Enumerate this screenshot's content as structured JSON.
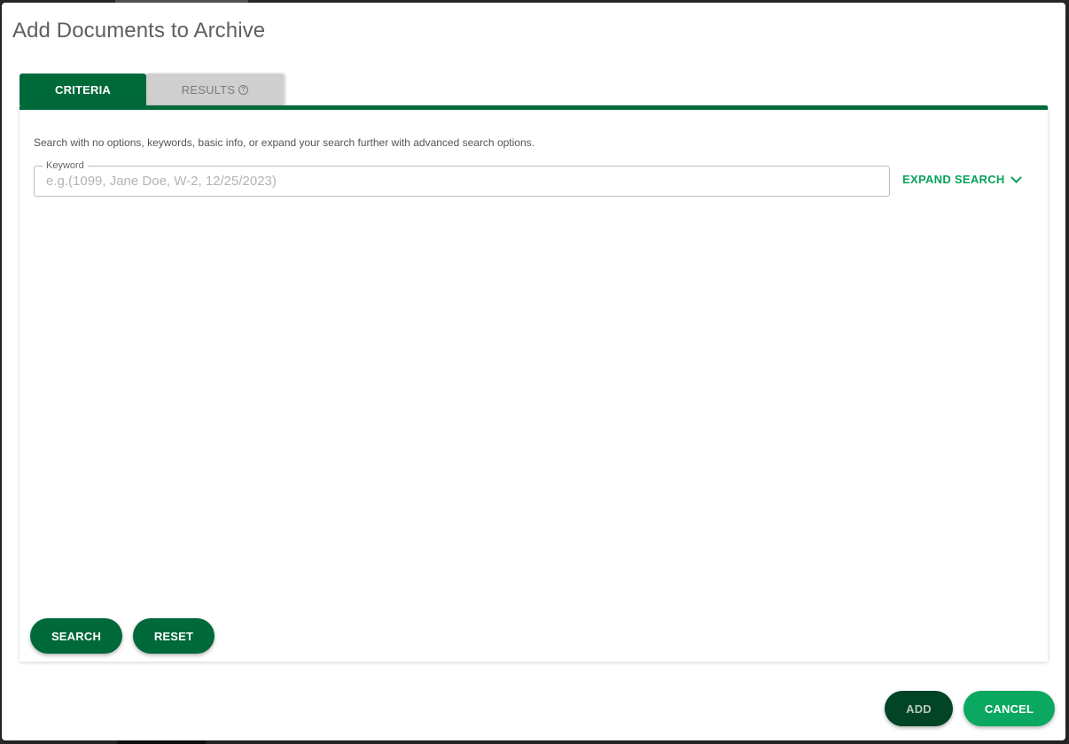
{
  "dialog": {
    "title": "Add Documents to Archive"
  },
  "tabs": [
    {
      "label": "CRITERIA",
      "active": true
    },
    {
      "label": "RESULTS",
      "active": false
    }
  ],
  "criteria": {
    "instructions": "Search with no options, keywords, basic info, or expand your search further with advanced search options.",
    "keyword_label": "Keyword",
    "keyword_value": "",
    "keyword_placeholder": "e.g.(1099, Jane Doe, W-2, 12/25/2023)",
    "expand_search_label": "EXPAND SEARCH",
    "search_label": "SEARCH",
    "reset_label": "RESET"
  },
  "footer": {
    "add_label": "ADD",
    "cancel_label": "CANCEL"
  },
  "colors": {
    "primary_green": "#00693a",
    "accent_green": "#0aa15a",
    "cancel_green": "#0aa860",
    "add_dark_green": "#024426",
    "inactive_tab": "#cfcfcf"
  },
  "icons": {
    "results_tab_icon": "help-circle-icon",
    "expand_icon": "chevron-down-icon"
  }
}
